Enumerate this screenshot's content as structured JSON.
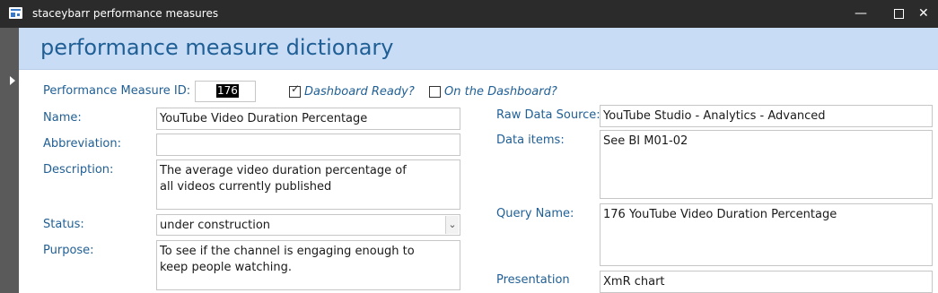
{
  "window": {
    "title": "staceybarr performance measures",
    "minimize_glyph": "—",
    "close_glyph": "✕"
  },
  "form": {
    "title": "performance measure dictionary"
  },
  "fields": {
    "id": {
      "label": "Performance Measure ID:",
      "value": "176"
    },
    "dashboard_ready": {
      "label": "Dashboard Ready?",
      "checked": true
    },
    "on_dashboard": {
      "label": "On the Dashboard?",
      "checked": false
    },
    "name": {
      "label": "Name:",
      "value": "YouTube Video Duration Percentage"
    },
    "abbreviation": {
      "label": "Abbreviation:",
      "value": ""
    },
    "description": {
      "label": "Description:",
      "value": "The average video duration percentage of all videos currently published"
    },
    "status": {
      "label": "Status:",
      "value": "under construction"
    },
    "purpose": {
      "label": "Purpose:",
      "value": "To see if the channel is engaging enough to keep people watching."
    },
    "raw_data_source": {
      "label": "Raw Data Source:",
      "value": "YouTube Studio - Analytics - Advanced"
    },
    "data_items": {
      "label": "Data items:",
      "value": "See BI M01-02"
    },
    "query_name": {
      "label": "Query Name:",
      "value": "176 YouTube Video Duration Percentage"
    },
    "presentation": {
      "label": "Presentation",
      "value": "XmR chart"
    }
  },
  "icons": {
    "checkmark": "✓",
    "dropdown": "⌄"
  }
}
